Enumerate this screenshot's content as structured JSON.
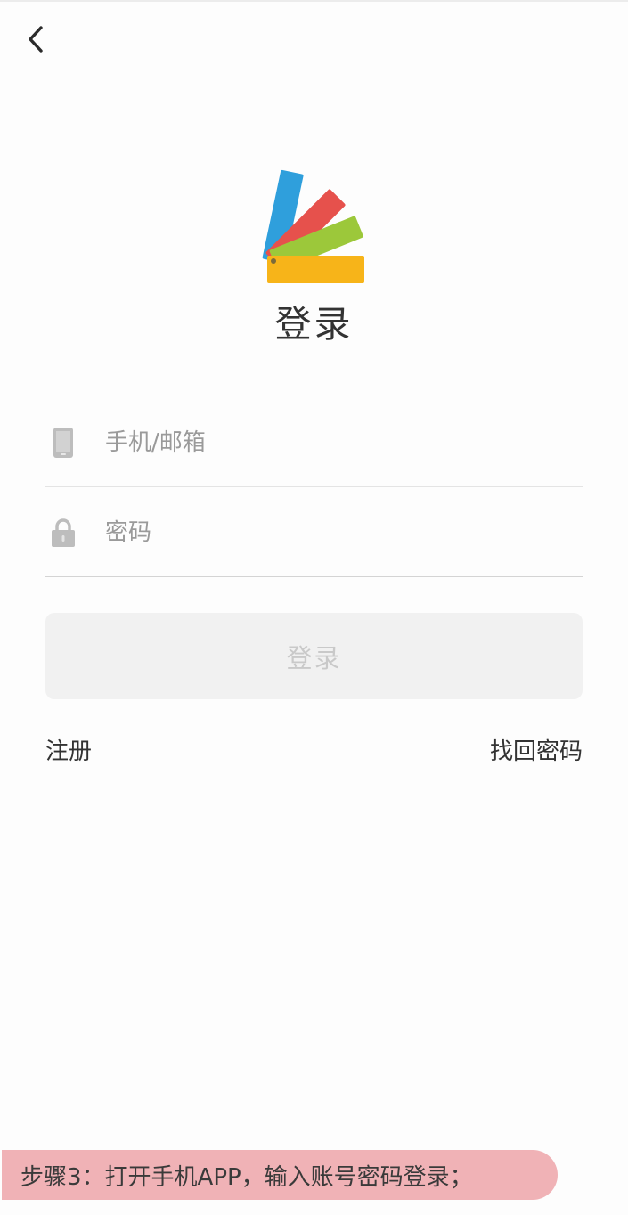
{
  "header": {
    "back_icon": "chevron-left-icon"
  },
  "logo": {
    "icon": "color-swatch-fan-logo",
    "colors": [
      "#2f9fdc",
      "#e6514c",
      "#9cc83a",
      "#f7b419"
    ]
  },
  "page": {
    "title": "登录"
  },
  "form": {
    "phone": {
      "icon": "phone-icon",
      "placeholder": "手机/邮箱",
      "value": ""
    },
    "password": {
      "icon": "lock-icon",
      "placeholder": "密码",
      "value": ""
    },
    "submit_label": "登录"
  },
  "links": {
    "register": "注册",
    "forgot_password": "找回密码"
  },
  "caption": {
    "text": "步骤3：打开手机APP，输入账号密码登录；",
    "background": "#f0b2b6"
  }
}
